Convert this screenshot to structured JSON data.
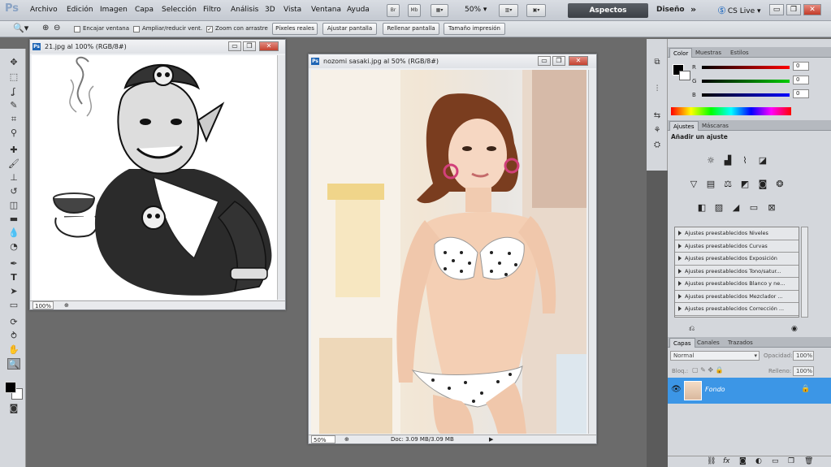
{
  "menubar": {
    "logo": "Ps",
    "items": [
      "Archivo",
      "Edición",
      "Imagen",
      "Capa",
      "Selección",
      "Filtro",
      "Análisis",
      "3D",
      "Vista",
      "Ventana",
      "Ayuda"
    ],
    "bridge": "Br",
    "minibridge": "Mb",
    "zoom": "50%",
    "workspace_active": "Aspectos esenciales",
    "workspace_other": "Diseño",
    "more": "»",
    "cslive": "CS Live"
  },
  "options": {
    "resize_windows": "Encajar ventana",
    "zoom_all": "Ampliar/reducir vent.",
    "scrubby_zoom": "Zoom con arrastre",
    "actual_pixels": "Píxeles reales",
    "fit_screen": "Ajustar pantalla",
    "fill_screen": "Rellenar pantalla",
    "print_size": "Tamaño impresión"
  },
  "doc1": {
    "title": "21.jpg al 100% (RGB/8#)",
    "zoom": "100%"
  },
  "doc2": {
    "title": "nozomi sasaki.jpg al 50% (RGB/8#)",
    "zoom": "50%",
    "info": "Doc: 3.09 MB/3.09 MB"
  },
  "color_panel": {
    "tabs": [
      "Color",
      "Muestras",
      "Estilos"
    ],
    "r_label": "R",
    "g_label": "G",
    "b_label": "B",
    "r": "0",
    "g": "0",
    "b": "0"
  },
  "adjust_panel": {
    "tabs": [
      "Ajustes",
      "Máscaras"
    ],
    "heading": "Añadir un ajuste",
    "presets": [
      "Ajustes preestablecidos Niveles",
      "Ajustes preestablecidos Curvas",
      "Ajustes preestablecidos Exposición",
      "Ajustes preestablecidos Tono/satur...",
      "Ajustes preestablecidos Blanco y ne...",
      "Ajustes preestablecidos Mezclador ...",
      "Ajustes preestablecidos Corrección ..."
    ]
  },
  "layers_panel": {
    "tabs": [
      "Capas",
      "Canales",
      "Trazados"
    ],
    "blend_mode": "Normal",
    "opacity_label": "Opacidad:",
    "opacity": "100%",
    "lock_label": "Bloq.:",
    "fill_label": "Relleno:",
    "fill": "100%",
    "layer_name": "Fondo"
  },
  "colors": {
    "accent": "#3c96e6",
    "workspace_bg": "#6b6b6b"
  }
}
